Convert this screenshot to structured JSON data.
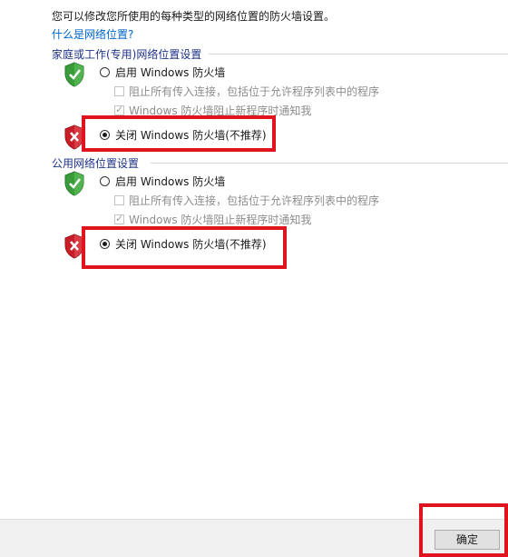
{
  "description": "您可以修改您所使用的每种类型的网络位置的防火墙设置。",
  "help_link": "什么是网络位置?",
  "sections": [
    {
      "title": "家庭或工作(专用)网络位置设置",
      "enable_label": "启用 Windows 防火墙",
      "block_label": "阻止所有传入连接，包括位于允许程序列表中的程序",
      "notify_label": "Windows 防火墙阻止新程序时通知我",
      "disable_label": "关闭 Windows 防火墙(不推荐)",
      "selected": "disable"
    },
    {
      "title": "公用网络位置设置",
      "enable_label": "启用 Windows 防火墙",
      "block_label": "阻止所有传入连接，包括位于允许程序列表中的程序",
      "notify_label": "Windows 防火墙阻止新程序时通知我",
      "disable_label": "关闭 Windows 防火墙(不推荐)",
      "selected": "disable"
    }
  ],
  "footer": {
    "ok_label": "确定"
  },
  "colors": {
    "highlight": "#e0141e",
    "link": "#0066cc",
    "shield_green": "#3a9b3a",
    "shield_red": "#c81e28"
  },
  "icons": {
    "enabled": "green-shield-check-icon",
    "disabled": "red-shield-x-icon"
  }
}
